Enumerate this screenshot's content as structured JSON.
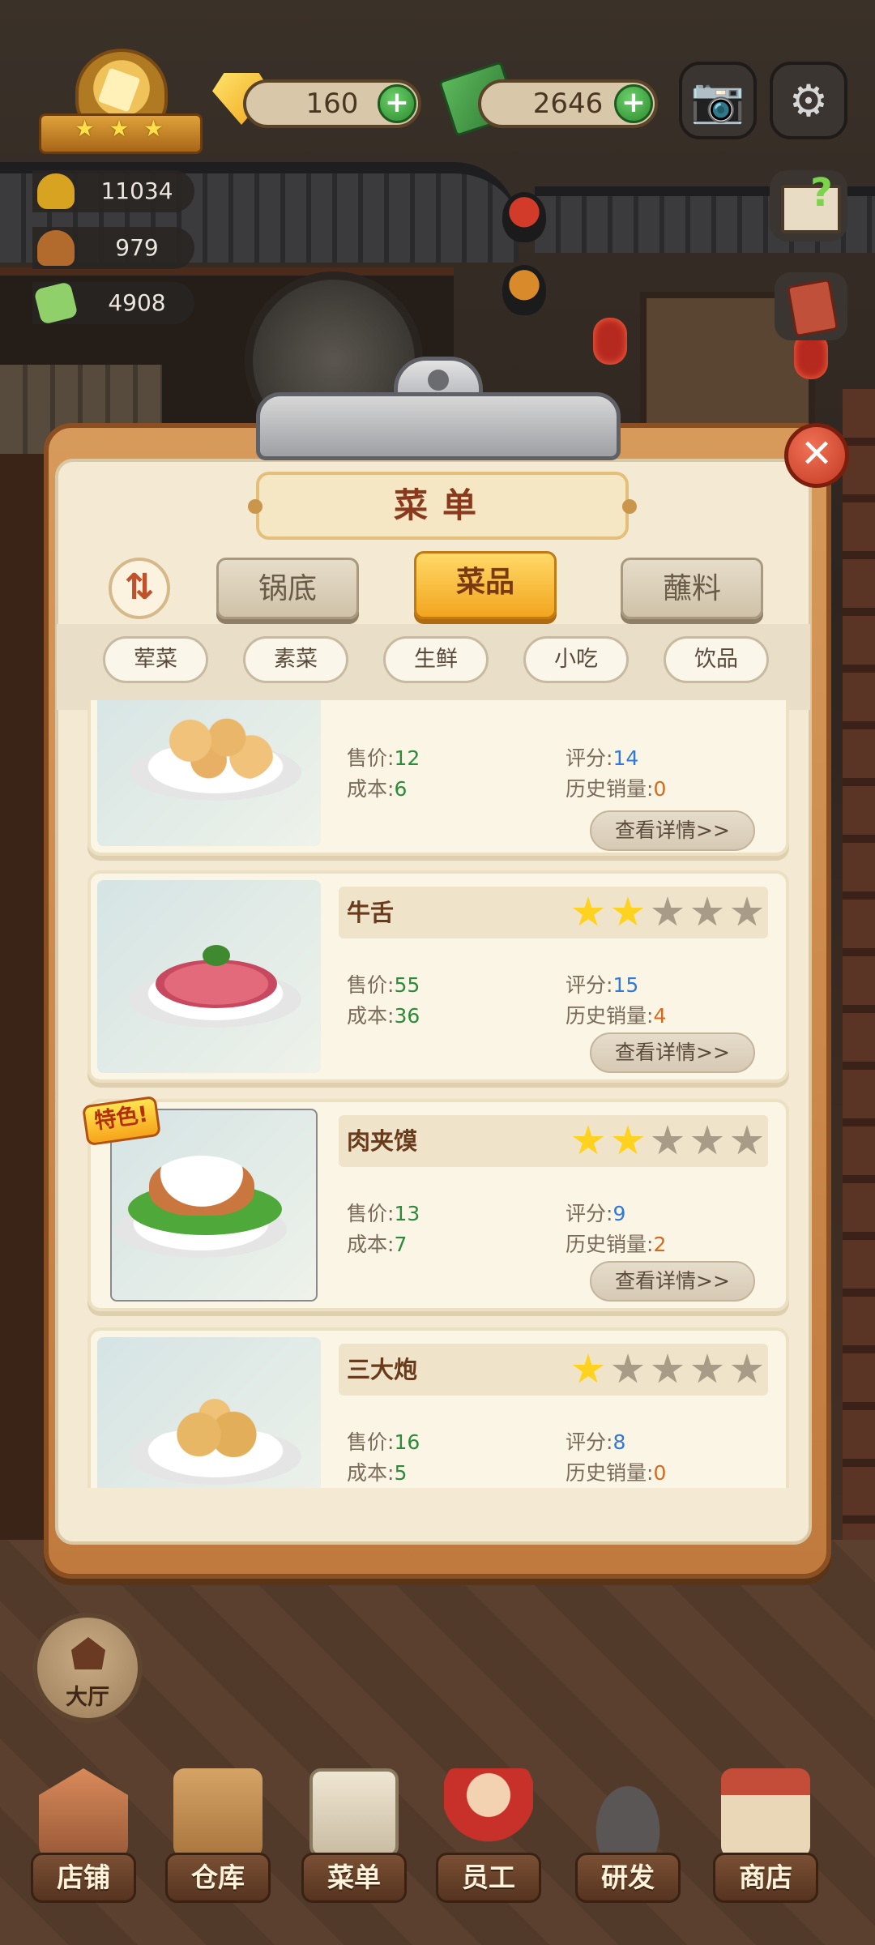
{
  "hud": {
    "gems": "160",
    "cash": "2646",
    "plus": "+",
    "stats": [
      "11034",
      "979",
      "4908"
    ]
  },
  "menu": {
    "title": "菜单",
    "close": "✕",
    "sort_icon": "⇅",
    "tabs": [
      "锅底",
      "菜品",
      "蘸料"
    ],
    "active_tab": "菜品",
    "filters": [
      "荤菜",
      "素菜",
      "生鲜",
      "小吃",
      "饮品"
    ],
    "labels": {
      "price": "售价:",
      "cost": "成本:",
      "score": "评分:",
      "sales": "历史销量:",
      "detail": "查看详情>>"
    },
    "special_tag": "特色!",
    "dishes": [
      {
        "name": "",
        "rating": 0,
        "price": "12",
        "cost": "6",
        "score": "14",
        "sales": "0",
        "special": false
      },
      {
        "name": "牛舌",
        "rating": 2,
        "price": "55",
        "cost": "36",
        "score": "15",
        "sales": "4",
        "special": false
      },
      {
        "name": "肉夹馍",
        "rating": 2,
        "price": "13",
        "cost": "7",
        "score": "9",
        "sales": "2",
        "special": true
      },
      {
        "name": "三大炮",
        "rating": 1,
        "price": "16",
        "cost": "5",
        "score": "8",
        "sales": "0",
        "special": false
      }
    ]
  },
  "hall": "大厅",
  "nav": [
    "店铺",
    "仓库",
    "菜单",
    "员工",
    "研发",
    "商店"
  ],
  "colors": {
    "accent": "#f2a51f",
    "price": "#2c8a3a",
    "score": "#2f7ad8",
    "sales": "#d26a1f"
  }
}
